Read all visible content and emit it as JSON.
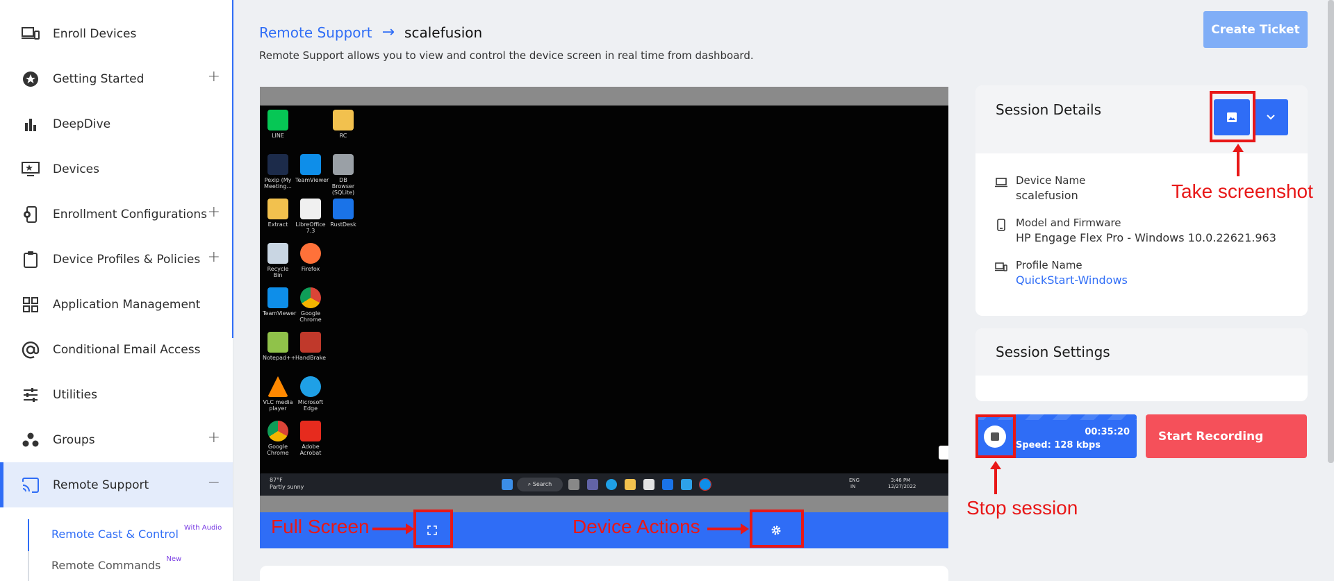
{
  "sidebar": {
    "items": [
      {
        "label": "Enroll Devices",
        "icon": "laptop-phone-icon",
        "expandable": false
      },
      {
        "label": "Getting Started",
        "icon": "star-circle-icon",
        "expandable": true
      },
      {
        "label": "DeepDive",
        "icon": "bar-chart-icon",
        "expandable": false
      },
      {
        "label": "Devices",
        "icon": "monitor-star-icon",
        "expandable": false
      },
      {
        "label": "Enrollment Configurations",
        "icon": "phone-gear-icon",
        "expandable": true
      },
      {
        "label": "Device Profiles & Policies",
        "icon": "clipboard-icon",
        "expandable": true
      },
      {
        "label": "Application Management",
        "icon": "grid-apps-icon",
        "expandable": false
      },
      {
        "label": "Conditional Email Access",
        "icon": "at-sign-icon",
        "expandable": false
      },
      {
        "label": "Utilities",
        "icon": "sliders-icon",
        "expandable": false
      },
      {
        "label": "Groups",
        "icon": "group-dots-icon",
        "expandable": true
      },
      {
        "label": "Remote Support",
        "icon": "cast-icon",
        "expandable": true,
        "expanded": true,
        "active": true
      }
    ],
    "sub_items": [
      {
        "label": "Remote Cast & Control",
        "badge": "With Audio",
        "active": true
      },
      {
        "label": "Remote Commands",
        "badge": "New",
        "active": false
      }
    ],
    "plus_symbol": "+",
    "minus_symbol": "−"
  },
  "header": {
    "breadcrumb_root": "Remote Support",
    "breadcrumb_arrow": "→",
    "breadcrumb_current": "scalefusion",
    "subtitle": "Remote Support allows you to view and control the device screen in real time from dashboard.",
    "create_ticket_label": "Create Ticket"
  },
  "remote_desktop": {
    "icons": [
      {
        "label": "LINE",
        "color": "#06c755"
      },
      {
        "label": "RC",
        "color": "#f2c14e"
      },
      {
        "label": "Pexip (My Meeting...",
        "color": "#1c2b4a"
      },
      {
        "label": "TeamViewer",
        "color": "#0e8ee9"
      },
      {
        "label": "DB Browser (SQLite)",
        "color": "#9aa0a6"
      },
      {
        "label": "Extract",
        "color": "#f2c14e"
      },
      {
        "label": "LibreOffice 7.3",
        "color": "#f0f0f0"
      },
      {
        "label": "RustDesk",
        "color": "#1a73e8"
      },
      {
        "label": "Recycle Bin",
        "color": "#c9d6e3"
      },
      {
        "label": "Firefox",
        "color": "#ff7139"
      },
      {
        "label": "TeamViewer",
        "color": "#0e8ee9"
      },
      {
        "label": "Google Chrome",
        "color": "#db4437"
      },
      {
        "label": "Notepad++",
        "color": "#90c24a"
      },
      {
        "label": "HandBrake",
        "color": "#c0392b"
      },
      {
        "label": "VLC media player",
        "color": "#ff8800"
      },
      {
        "label": "Microsoft Edge",
        "color": "#1fa0e6"
      },
      {
        "label": "Google Chrome",
        "color": "#db4437"
      },
      {
        "label": "Adobe Acrobat",
        "color": "#e62b1e"
      }
    ],
    "taskbar": {
      "weather_temp": "87°F",
      "weather_text": "Partly sunny",
      "search_label": "Search",
      "lang": "ENG",
      "region": "IN",
      "time": "3:46 PM",
      "date": "12/27/2022"
    }
  },
  "annotations": {
    "full_screen": "Full Screen",
    "device_actions": "Device Actions",
    "take_screenshot": "Take screenshot",
    "stop_session": "Stop session"
  },
  "session_details": {
    "title": "Session Details",
    "device_name_label": "Device Name",
    "device_name_value": "scalefusion",
    "model_label": "Model and Firmware",
    "model_value": "HP Engage Flex Pro - Windows 10.0.22621.963",
    "profile_label": "Profile Name",
    "profile_value": "QuickStart-Windows"
  },
  "session_settings": {
    "title": "Session Settings"
  },
  "session_control": {
    "timer": "00:35:20",
    "speed": "Speed: 128 kbps",
    "start_recording_label": "Start Recording"
  },
  "colors": {
    "accent": "#2f6df6",
    "annotation_red": "#e81818",
    "record_red": "#f5505a"
  }
}
